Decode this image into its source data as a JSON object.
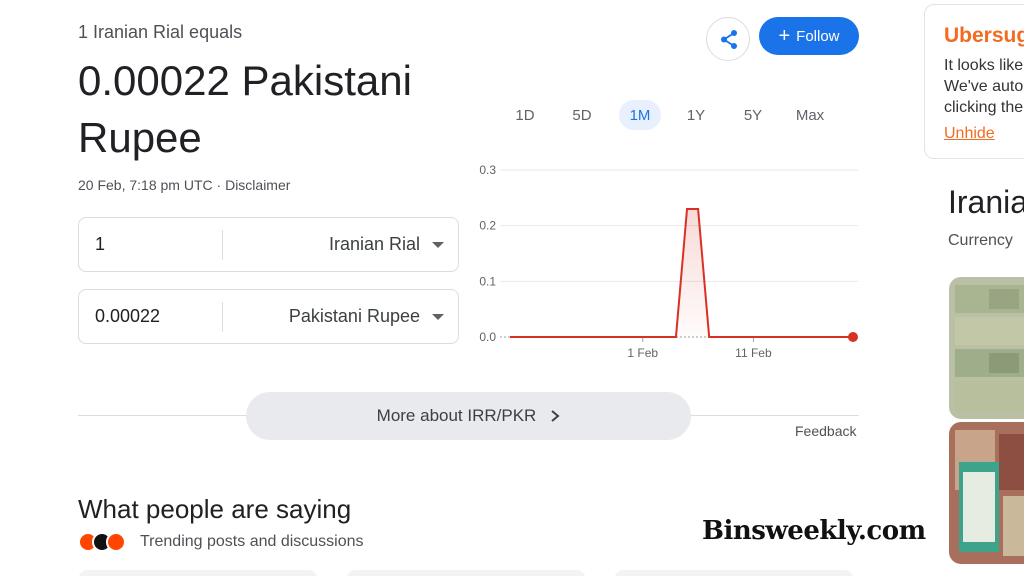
{
  "converter": {
    "equals_label": "1 Iranian Rial equals",
    "result_text": "0.00022 Pakistani Rupee",
    "timestamp": "20 Feb, 7:18 pm UTC",
    "separator": " · ",
    "disclaimer": "Disclaimer",
    "from": {
      "amount": "1",
      "currency": "Iranian Rial"
    },
    "to": {
      "amount": "0.00022",
      "currency": "Pakistani Rupee"
    }
  },
  "actions": {
    "share_icon": "share-icon",
    "follow_icon": "+",
    "follow_label": "Follow"
  },
  "range_tabs": [
    {
      "label": "1D",
      "active": false
    },
    {
      "label": "5D",
      "active": false
    },
    {
      "label": "1M",
      "active": true
    },
    {
      "label": "1Y",
      "active": false
    },
    {
      "label": "5Y",
      "active": false
    },
    {
      "label": "Max",
      "active": false
    }
  ],
  "chart_data": {
    "type": "area",
    "title": "",
    "xlabel": "",
    "ylabel": "",
    "x_tick_labels": [
      "1 Feb",
      "11 Feb"
    ],
    "y_tick_labels": [
      "0.0",
      "0.1",
      "0.2",
      "0.3"
    ],
    "ylim": [
      0,
      0.3
    ],
    "grid": true,
    "line_color": "#d93025",
    "series": [
      {
        "points": [
          {
            "x": "20 Jan",
            "y": 0.0
          },
          {
            "x": "4 Feb",
            "y": 0.0
          },
          {
            "x": "5 Feb",
            "y": 0.23
          },
          {
            "x": "6 Feb",
            "y": 0.23
          },
          {
            "x": "7 Feb",
            "y": 0.0
          },
          {
            "x": "20 Feb",
            "y": 0.0
          }
        ]
      }
    ]
  },
  "more_about_label": "More about IRR/PKR",
  "more_about_icon": "chevron-right-icon",
  "feedback_label": "Feedback",
  "people": {
    "title": "What people are saying",
    "trending_label": "Trending posts and discussions",
    "source_icons": [
      "reddit-icon",
      "x-icon",
      "reddit-icon"
    ]
  },
  "sponsor": {
    "brand": "Ubersug",
    "lines": [
      "It looks like",
      "We've auto",
      "clicking the"
    ],
    "unhide_label": "Unhide",
    "brand_color": "#f26b21"
  },
  "knowledge_panel": {
    "title": "Irania",
    "subtitle": "Currency"
  },
  "watermark": "Binsweekly.com",
  "colors": {
    "accent": "#1a73e8",
    "chart_red": "#d93025",
    "active_tab_bg": "#e8f0fe"
  }
}
